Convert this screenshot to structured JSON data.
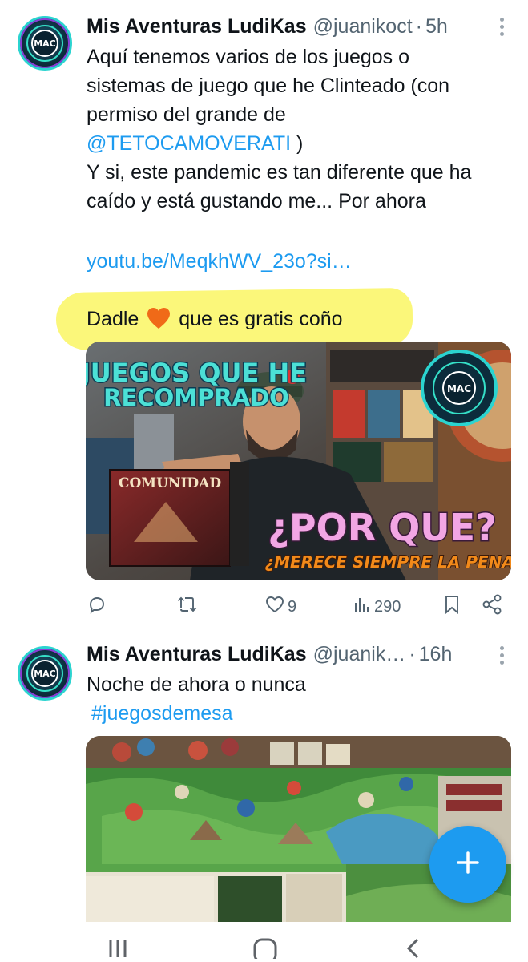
{
  "tweets": [
    {
      "author_name": "Mis Aventuras LudiKas",
      "handle": "@juanikoct",
      "time": "5h",
      "text_lines": [
        "Aquí tenemos varios de los juegos o",
        "sistemas de juego que he Clinteado (con",
        "permiso del grande de"
      ],
      "mention": "@TETOCAMOVERATI",
      "mention_suffix": " )",
      "text_lines_2": [
        "Y si, este pandemic es tan diferente que ha",
        "caído y está gustando me... Por ahora"
      ],
      "link": "youtu.be/MeqkhWV_23o?si…",
      "highlight_before": "Dadle",
      "highlight_after": "que es gratis coño",
      "media": {
        "title_line_1": "JUEGOS QUE HE",
        "title_line_2": "RECOMPRADO",
        "big_caption": "¿POR QUE?",
        "sub_caption": "¿MERECE SIEMPRE LA PENA?",
        "box_title": "COMUNIDAD",
        "badge": "MAC"
      },
      "actions": {
        "reply_count": "",
        "retweet_count": "",
        "like_count": "9",
        "views_count": "290"
      }
    },
    {
      "author_name": "Mis Aventuras LudiKas",
      "handle": "@juanik…",
      "time": "16h",
      "text": "Noche de ahora o nunca",
      "hashtag": "#juegosdemesa"
    }
  ],
  "avatar_monogram": "MAC",
  "icons": [
    "more-icon",
    "reply-icon",
    "retweet-icon",
    "like-icon",
    "views-icon",
    "bookmark-icon",
    "share-icon",
    "compose-icon",
    "recents-icon",
    "home-icon",
    "back-icon",
    "heart-emoji-icon"
  ],
  "colors": {
    "link": "#1d9bf0",
    "highlight": "#fbf77a",
    "fab": "#1d9bf0",
    "secondary_text": "#536471"
  }
}
